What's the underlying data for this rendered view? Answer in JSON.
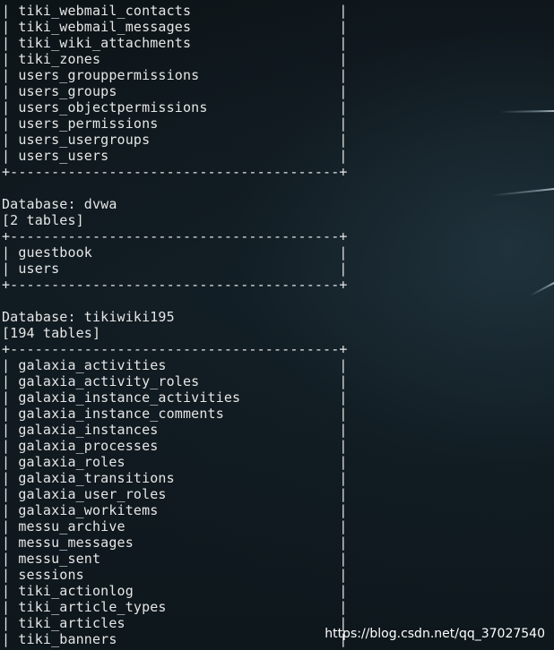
{
  "terminal": {
    "lines": [
      "| tiki_webmail_contacts                  |",
      "| tiki_webmail_messages                  |",
      "| tiki_wiki_attachments                  |",
      "| tiki_zones                             |",
      "| users_grouppermissions                 |",
      "| users_groups                           |",
      "| users_objectpermissions                |",
      "| users_permissions                      |",
      "| users_usergroups                       |",
      "| users_users                            |",
      "+----------------------------------------+",
      "",
      "Database: dvwa",
      "[2 tables]",
      "+----------------------------------------+",
      "| guestbook                              |",
      "| users                                  |",
      "+----------------------------------------+",
      "",
      "Database: tikiwiki195",
      "[194 tables]",
      "+----------------------------------------+",
      "| galaxia_activities                     |",
      "| galaxia_activity_roles                 |",
      "| galaxia_instance_activities            |",
      "| galaxia_instance_comments              |",
      "| galaxia_instances                      |",
      "| galaxia_processes                      |",
      "| galaxia_roles                          |",
      "| galaxia_transitions                    |",
      "| galaxia_user_roles                     |",
      "| galaxia_workitems                      |",
      "| messu_archive                          |",
      "| messu_messages                         |",
      "| messu_sent                             |",
      "| sessions                               |",
      "| tiki_actionlog                         |",
      "| tiki_article_types                     |",
      "| tiki_articles                          |",
      "| tiki_banners                           |"
    ]
  },
  "watermark": {
    "text": "https://blog.csdn.net/qq_37027540"
  },
  "colors": {
    "text": "#e6e6e6",
    "background": "#0d1418"
  }
}
